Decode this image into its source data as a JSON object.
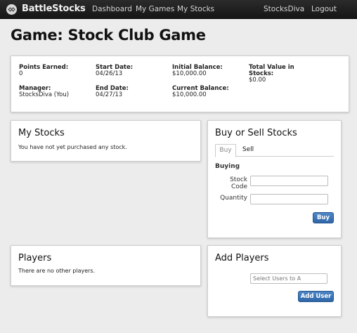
{
  "navbar": {
    "brand": "BattleStocks",
    "links": [
      "Dashboard",
      "My Games",
      "My Stocks"
    ],
    "user": "StocksDiva",
    "logout": "Logout",
    "logo_icon": "battlestocks-logo-icon"
  },
  "page": {
    "title": "Game: Stock Club Game"
  },
  "summary": {
    "points_label": "Points Earned:",
    "points_value": "0",
    "start_label": "Start Date:",
    "start_value": "04/26/13",
    "initial_label": "Initial Balance:",
    "initial_value": "$10,000.00",
    "total_label_1": "Total Value in",
    "total_label_2": "Stocks:",
    "total_value": "$0.00",
    "manager_label": "Manager:",
    "manager_value": "StocksDiva (You)",
    "end_label": "End Date:",
    "end_value": "04/27/13",
    "current_label": "Current Balance:",
    "current_value": "$10,000.00"
  },
  "my_stocks": {
    "title": "My Stocks",
    "message": "You have not yet purchased any stock."
  },
  "buy_sell": {
    "title": "Buy or Sell Stocks",
    "tabs": [
      "Buy",
      "Sell"
    ],
    "active_tab": "Buy",
    "section_label": "Buying",
    "stock_code_label_1": "Stock",
    "stock_code_label_2": "Code",
    "stock_code_value": "",
    "quantity_label": "Quantity",
    "quantity_value": "",
    "submit": "Buy"
  },
  "players": {
    "title": "Players",
    "message": "There are no other players."
  },
  "add_players": {
    "title": "Add Players",
    "placeholder": "Select Users to A",
    "submit": "Add User"
  },
  "colors": {
    "accent": "#3a72b6",
    "navbar": "#1c1c1c",
    "background": "#ececec"
  }
}
